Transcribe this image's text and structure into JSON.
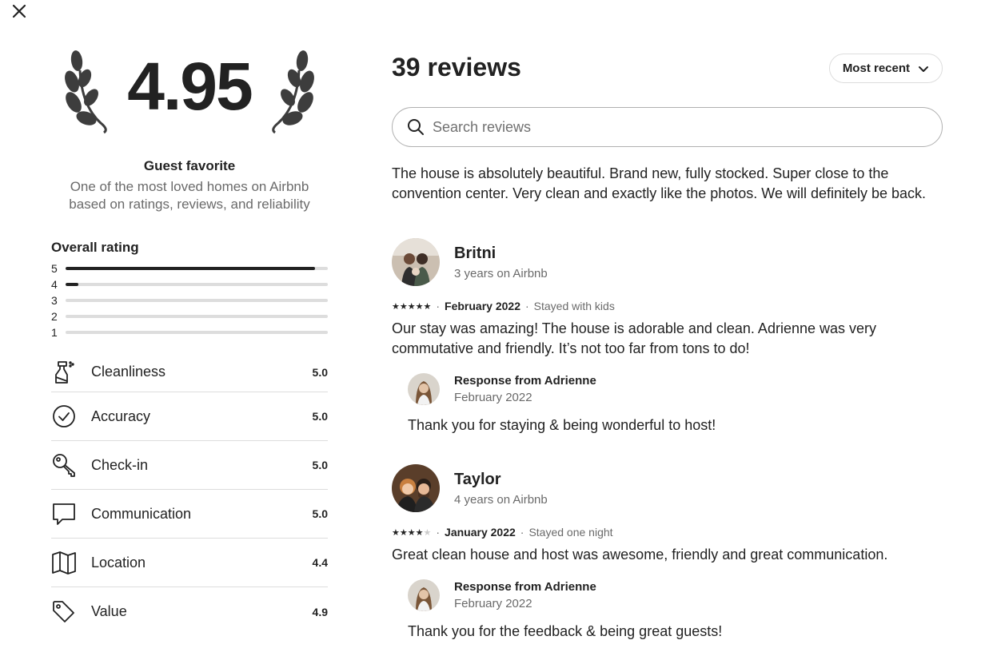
{
  "header": {
    "close_icon": "close-icon"
  },
  "summary": {
    "rating": "4.95",
    "badge_title": "Guest favorite",
    "badge_desc_line1": "One of the most loved homes on Airbnb",
    "badge_desc_line2": "based on ratings, reviews, and reliability"
  },
  "overall": {
    "title": "Overall rating",
    "bars": [
      {
        "label": "5",
        "fraction": 0.95
      },
      {
        "label": "4",
        "fraction": 0.05
      },
      {
        "label": "3",
        "fraction": 0
      },
      {
        "label": "2",
        "fraction": 0
      },
      {
        "label": "1",
        "fraction": 0
      }
    ]
  },
  "categories": [
    {
      "label": "Cleanliness",
      "value": "5.0",
      "icon": "spray-bottle-icon"
    },
    {
      "label": "Accuracy",
      "value": "5.0",
      "icon": "check-circle-icon"
    },
    {
      "label": "Check-in",
      "value": "5.0",
      "icon": "key-icon"
    },
    {
      "label": "Communication",
      "value": "5.0",
      "icon": "chat-bubble-icon"
    },
    {
      "label": "Location",
      "value": "4.4",
      "icon": "map-icon"
    },
    {
      "label": "Value",
      "value": "4.9",
      "icon": "tag-icon"
    }
  ],
  "reviews_panel": {
    "title": "39 reviews",
    "sort_label": "Most recent",
    "search_placeholder": "Search reviews"
  },
  "reviews": [
    {
      "body": "The house is absolutely beautiful. Brand new, fully stocked. Super close to the convention center. Very clean and exactly like the photos. We will definitely be back."
    },
    {
      "name": "Britni",
      "since": "3 years on Airbnb",
      "stars": 5,
      "date": "February 2022",
      "trip": "Stayed with kids",
      "body": "Our stay was amazing! The house is adorable and clean. Adrienne was very commutative and friendly. It’s not too far from tons to do!",
      "response": {
        "title": "Response from Adrienne",
        "date": "February 2022",
        "body": "Thank you for staying & being wonderful to host!"
      }
    },
    {
      "name": "Taylor",
      "since": "4 years on Airbnb",
      "stars": 4,
      "date": "January 2022",
      "trip": "Stayed one night",
      "body": "Great clean house and host was awesome, friendly and great communication.",
      "response": {
        "title": "Response from Adrienne",
        "date": "February 2022",
        "body": "Thank you for the feedback & being great guests!"
      }
    }
  ]
}
